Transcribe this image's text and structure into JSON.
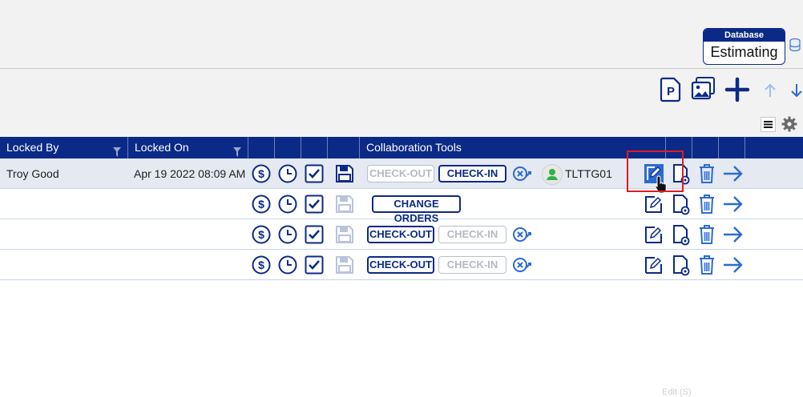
{
  "database": {
    "header": "Database",
    "value": "Estimating"
  },
  "toolbar": {
    "icons": [
      "p-document-icon",
      "images-icon",
      "plus-icon",
      "arrow-up-icon",
      "arrow-down-icon"
    ]
  },
  "grid": {
    "columns": [
      "Locked By",
      "Locked On",
      "",
      "",
      "",
      "",
      "Collaboration Tools"
    ],
    "rows": [
      {
        "locked_by": "Troy  Good",
        "locked_on": "Apr 19 2022 08:09 AM",
        "checkout": "CHECK-OUT",
        "checkin": "CHECK-IN",
        "user": "TLTTG01"
      },
      {
        "locked_by": "",
        "locked_on": "",
        "change_orders": "CHANGE ORDERS"
      },
      {
        "locked_by": "",
        "locked_on": "",
        "checkout": "CHECK-OUT",
        "checkin": "CHECK-IN"
      },
      {
        "locked_by": "",
        "locked_on": "",
        "checkout": "CHECK-OUT",
        "checkin": "CHECK-IN"
      }
    ]
  },
  "tooltip": "Edit (S)",
  "colors": {
    "primary": "#0b2a87",
    "accent": "#1a73e8",
    "highlight": "#e01b24",
    "user": "#2fb34a"
  }
}
